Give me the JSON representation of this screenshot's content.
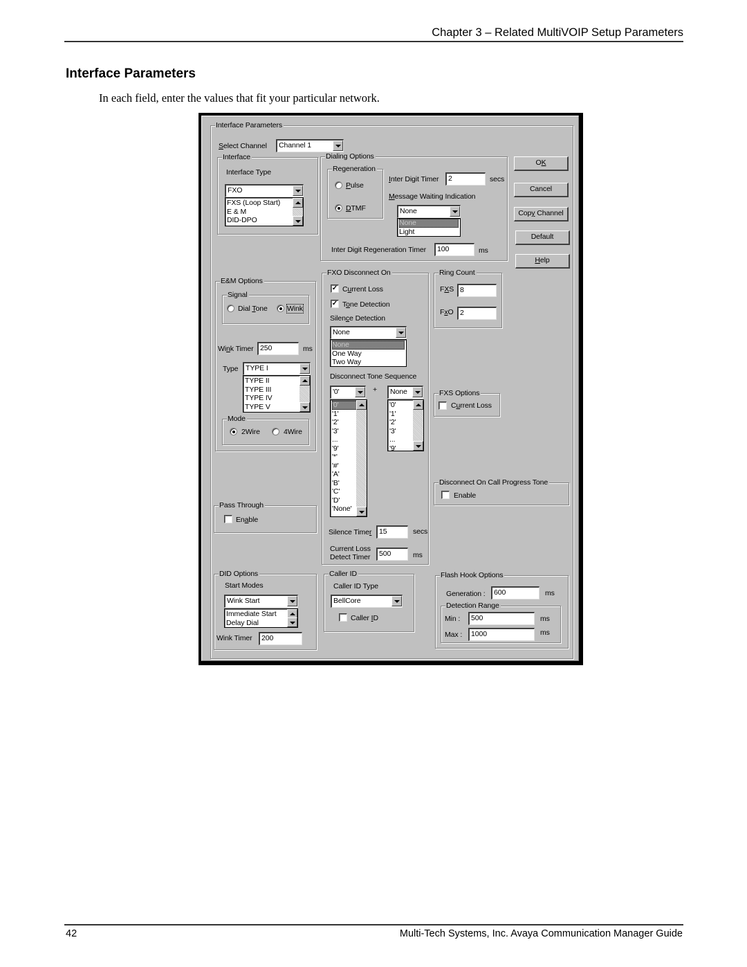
{
  "page": {
    "header": "Chapter 3 – Related MultiVOIP Setup Parameters",
    "section_title": "Interface Parameters",
    "intro": "In each field, enter the values that fit  your particular network.",
    "page_number": "42",
    "footer": "Multi-Tech Systems, Inc. Avaya Communication Manager Guide"
  },
  "dialog": {
    "group_title": "Interface Parameters",
    "select_channel": {
      "label": "Select Channel",
      "value": "Channel 1"
    },
    "interface": {
      "title": "Interface",
      "type_label": "Interface Type",
      "type_value": "FXO",
      "type_options": [
        "FXS (Loop Start)",
        "E & M",
        "DID-DPO"
      ]
    },
    "dialing_options": {
      "title": "Dialing Options",
      "regeneration": {
        "title": "Regeneration",
        "pulse": "Pulse",
        "dtmf": "DTMF",
        "selected": "DTMF"
      },
      "inter_digit_timer": {
        "label": "Inter Digit Timer",
        "value": "2",
        "unit": "secs"
      },
      "mwi": {
        "label": "Message Waiting Indication",
        "value": "None",
        "options": [
          "None",
          "Light"
        ],
        "highlighted": "None"
      },
      "regen_timer": {
        "label": "Inter Digit Regeneration Timer",
        "value": "100",
        "unit": "ms"
      }
    },
    "buttons": {
      "ok": "OK",
      "cancel": "Cancel",
      "copy_channel": "Copy Channel",
      "default": "Default",
      "help": "Help"
    },
    "em_options": {
      "title": "E&M Options",
      "signal": {
        "title": "Signal",
        "dial_tone": "Dial Tone",
        "wink": "Wink",
        "selected": "Wink"
      },
      "wink_timer": {
        "label": "Wink Timer",
        "value": "250",
        "unit": "ms"
      },
      "type": {
        "label": "Type",
        "value": "TYPE I",
        "options": [
          "TYPE II",
          "TYPE III",
          "TYPE IV",
          "TYPE V"
        ]
      },
      "mode": {
        "title": "Mode",
        "two_wire": "2Wire",
        "four_wire": "4Wire",
        "selected": "2Wire"
      }
    },
    "fxo_disconnect": {
      "title": "FXO Disconnect On",
      "current_loss": {
        "label": "Current Loss",
        "checked": true
      },
      "tone_detection": {
        "label": "Tone Detection",
        "checked": true
      },
      "silence_detection": {
        "label": "Silence Detection",
        "value": "None",
        "options": [
          "None",
          "One Way",
          "Two Way"
        ],
        "highlighted": "None"
      },
      "tone_sequence": {
        "label": "Disconnect Tone Sequence",
        "first_value": "'0'",
        "plus": "+",
        "second_value": "None",
        "first_options": [
          "'0'",
          "'1'",
          "'2'",
          "'3'",
          "...",
          "'9'",
          "'*'",
          "'#'",
          "'A'",
          "'B'",
          "'C'",
          "'D'",
          "'None'"
        ],
        "second_options": [
          "'0'",
          "'1'",
          "'2'",
          "'3'",
          "...",
          "'9'"
        ]
      },
      "silence_timer": {
        "label": "Silence Timer",
        "value": "15",
        "unit": "secs"
      },
      "current_loss_timer": {
        "label1": "Current Loss",
        "label2": "Detect Timer",
        "value": "500",
        "unit": "ms"
      }
    },
    "ring_count": {
      "title": "Ring Count",
      "fxs_label": "FXS",
      "fxs_value": "8",
      "fxo_label": "FxO",
      "fxo_value": "2"
    },
    "fxs_options": {
      "title": "FXS Options",
      "current_loss": "Current  Loss",
      "checked": false
    },
    "call_progress": {
      "title": "Disconnect On Call Progress Tone",
      "enable": "Enable",
      "checked": false
    },
    "pass_through": {
      "title": "Pass Through",
      "enable": "Enable",
      "checked": false
    },
    "did_options": {
      "title": "DID Options",
      "start_modes_label": "Start Modes",
      "start_mode_value": "Wink Start",
      "start_mode_options": [
        "Immediate Start",
        "Delay Dial"
      ],
      "wink_timer_label": "Wink Timer",
      "wink_timer_value": "200"
    },
    "caller_id": {
      "title": "Caller ID",
      "type_label": "Caller ID Type",
      "type_value": "BellCore",
      "checkbox_label": "Caller ID",
      "checked": false
    },
    "flash_hook": {
      "title": "Flash Hook Options",
      "generation_label": "Generation :",
      "generation_value": "600",
      "unit": "ms",
      "detection_range": {
        "title": "Detection Range",
        "min_label": "Min :",
        "min_value": "500",
        "max_label": "Max :",
        "max_value": "1000"
      }
    }
  }
}
